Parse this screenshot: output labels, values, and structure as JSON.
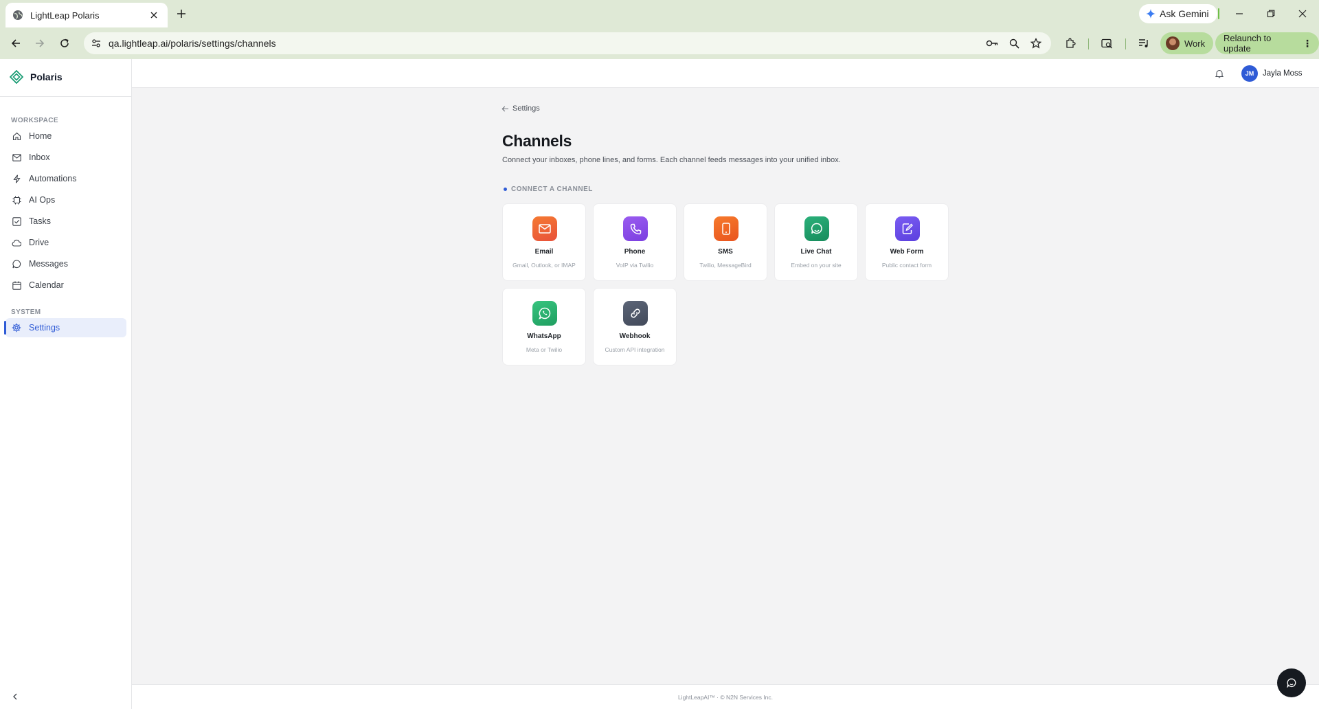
{
  "browser": {
    "tab_title": "LightLeap Polaris",
    "url": "qa.lightleap.ai/polaris/settings/channels",
    "ask_gemini": "Ask Gemini",
    "profile": "Work",
    "relaunch": "Relaunch to update"
  },
  "sidebar": {
    "brand": "Polaris",
    "workspace_label": "WORKSPACE",
    "system_label": "SYSTEM",
    "items": [
      {
        "label": "Home",
        "icon": "home-icon"
      },
      {
        "label": "Inbox",
        "icon": "mail-icon"
      },
      {
        "label": "Automations",
        "icon": "bolt-icon"
      },
      {
        "label": "AI Ops",
        "icon": "chip-icon"
      },
      {
        "label": "Tasks",
        "icon": "check-square-icon"
      },
      {
        "label": "Drive",
        "icon": "cloud-icon"
      },
      {
        "label": "Messages",
        "icon": "message-icon"
      },
      {
        "label": "Calendar",
        "icon": "calendar-icon"
      }
    ],
    "system_items": [
      {
        "label": "Settings",
        "icon": "gear-icon",
        "active": true
      }
    ]
  },
  "topbar": {
    "user_initials": "JM",
    "user_name": "Jayla Moss"
  },
  "page": {
    "back_label": "Settings",
    "title": "Channels",
    "description": "Connect your inboxes, phone lines, and forms. Each channel feeds messages into your unified inbox.",
    "group_label": "CONNECT A CHANNEL"
  },
  "channels": [
    {
      "name": "Email",
      "desc": "Gmail, Outlook, or IMAP",
      "icon": "mail-icon",
      "color": "#f0622f"
    },
    {
      "name": "Phone",
      "desc": "VoIP via Twilio",
      "icon": "phone-icon",
      "color": "#8b4fe6"
    },
    {
      "name": "SMS",
      "desc": "Twilio, MessageBird",
      "icon": "mobile-icon",
      "color": "#f06424"
    },
    {
      "name": "Live Chat",
      "desc": "Embed on your site",
      "icon": "chat-icon",
      "color": "#22a06b"
    },
    {
      "name": "Web Form",
      "desc": "Public contact form",
      "icon": "form-icon",
      "color": "#6a4fe6"
    },
    {
      "name": "WhatsApp",
      "desc": "Meta or Twilio",
      "icon": "whatsapp-icon",
      "color": "#2bb673"
    },
    {
      "name": "Webhook",
      "desc": "Custom API integration",
      "icon": "link-icon",
      "color": "#4d5667"
    }
  ],
  "footer": {
    "text": "LightLeapAI™ · © N2N Services Inc."
  }
}
